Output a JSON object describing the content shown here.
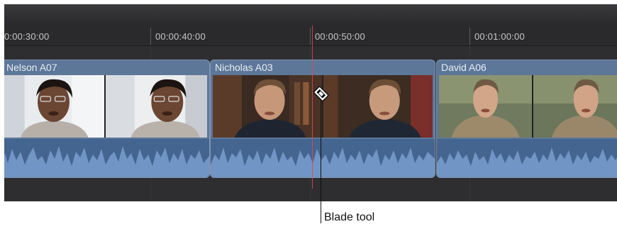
{
  "ruler": {
    "ticks": [
      "0:00:30:00",
      "00:00:40:00",
      "00:00:50:00",
      "00:01:00:00"
    ]
  },
  "clips": [
    {
      "title": "Nelson A07"
    },
    {
      "title": "Nicholas A03"
    },
    {
      "title": "David A06"
    }
  ],
  "tools": {
    "active_icon": "blade-icon"
  },
  "callout": {
    "label": "Blade tool"
  },
  "colors": {
    "clip_header": "#5d7799",
    "audio_wave": "#6f91c0",
    "audio_bg": "#43658f",
    "playhead": "#e0474f",
    "panel_bg": "#2b2b2e"
  }
}
